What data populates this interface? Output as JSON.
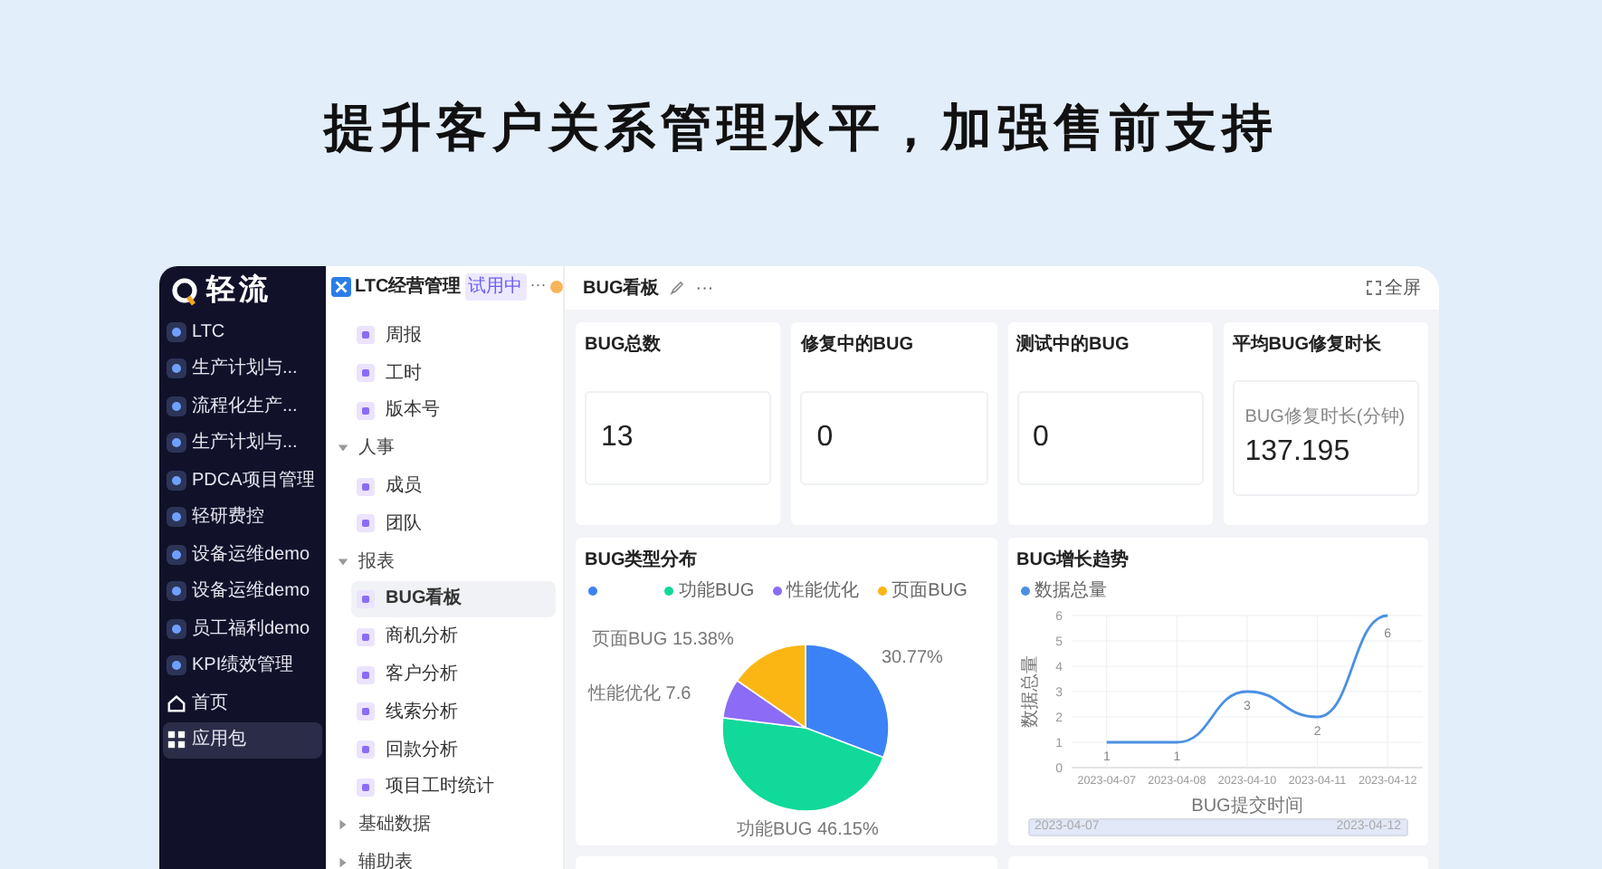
{
  "headline": "提升客户关系管理水平，加强售前支持",
  "sidebar": {
    "logo": "轻流",
    "items": [
      {
        "label": "LTC",
        "kind": "app",
        "selected": false
      },
      {
        "label": "生产计划与...",
        "kind": "app",
        "selected": false
      },
      {
        "label": "流程化生产...",
        "kind": "app",
        "selected": false
      },
      {
        "label": "生产计划与...",
        "kind": "app",
        "selected": false
      },
      {
        "label": "PDCA项目管理",
        "kind": "app",
        "selected": false
      },
      {
        "label": "轻研费控",
        "kind": "app",
        "selected": false
      },
      {
        "label": "设备运维demo",
        "kind": "app",
        "selected": false
      },
      {
        "label": "设备运维demo",
        "kind": "app",
        "selected": false
      },
      {
        "label": "员工福利demo",
        "kind": "app",
        "selected": false
      },
      {
        "label": "KPI绩效管理",
        "kind": "app",
        "selected": false
      },
      {
        "label": "首页",
        "kind": "home",
        "selected": false
      },
      {
        "label": "应用包",
        "kind": "grid",
        "selected": true
      }
    ]
  },
  "nav": {
    "title": "LTC经营管理",
    "badge": "试用中",
    "more": "···",
    "items": [
      {
        "label": "周报",
        "selected": false
      },
      {
        "label": "工时",
        "selected": false
      },
      {
        "label": "版本号",
        "selected": false
      },
      {
        "label": "人事",
        "expanded": true,
        "children": [
          {
            "label": "成员",
            "selected": false
          },
          {
            "label": "团队",
            "selected": false
          }
        ]
      },
      {
        "label": "报表",
        "expanded": true,
        "children": [
          {
            "label": "BUG看板",
            "selected": true
          },
          {
            "label": "商机分析",
            "selected": false
          },
          {
            "label": "客户分析",
            "selected": false
          },
          {
            "label": "线索分析",
            "selected": false
          },
          {
            "label": "回款分析",
            "selected": false
          },
          {
            "label": "项目工时统计",
            "selected": false
          }
        ]
      },
      {
        "label": "基础数据",
        "expanded": false
      },
      {
        "label": "辅助表",
        "expanded": false
      }
    ]
  },
  "dashboard": {
    "title": "BUG看板",
    "more": "···",
    "fullscreen": "全屏",
    "stats": [
      {
        "title": "BUG总数",
        "value": "13"
      },
      {
        "title": "修复中的BUG",
        "value": "0"
      },
      {
        "title": "测试中的BUG",
        "value": "0"
      },
      {
        "title": "平均BUG修复时长",
        "caption": "BUG修复时长(分钟)",
        "value": "137.195"
      }
    ],
    "pie": {
      "chart_data": {
        "type": "pie",
        "title": "BUG类型分布",
        "categories": [
          null,
          "功能BUG",
          "性能优化",
          "页面BUG"
        ],
        "series": [
          {
            "values": [
              30.77,
              46.15,
              7.69,
              15.38
            ]
          }
        ],
        "colors": [
          "#3b82f6",
          "#10d99a",
          "#8b6cf6",
          "#fbb614"
        ],
        "annotations": [
          "30.77%",
          "功能BUG 46.15%",
          "性能优化 7.6",
          "页面BUG 15.38%"
        ]
      }
    },
    "line": {
      "chart_data": {
        "type": "line",
        "title": "BUG增长趋势",
        "xlabel": "BUG提交时间",
        "ylabel": "数据总量",
        "categories": [
          "2023-04-07",
          "2023-04-08",
          "2023-04-10",
          "2023-04-11",
          "2023-04-12"
        ],
        "series": [
          {
            "name": "数据总量",
            "color": "#4a90e2",
            "values": [
              1,
              1,
              3,
              2,
              6
            ]
          }
        ],
        "ylim": [
          0,
          6
        ],
        "yticks": [
          0,
          1,
          2,
          3,
          4,
          5,
          6
        ],
        "data_labels": true,
        "grid": true
      },
      "zoom_start": "2023-04-07",
      "zoom_end": "2023-04-12",
      "zoom": {
        "level": 1
      }
    }
  }
}
